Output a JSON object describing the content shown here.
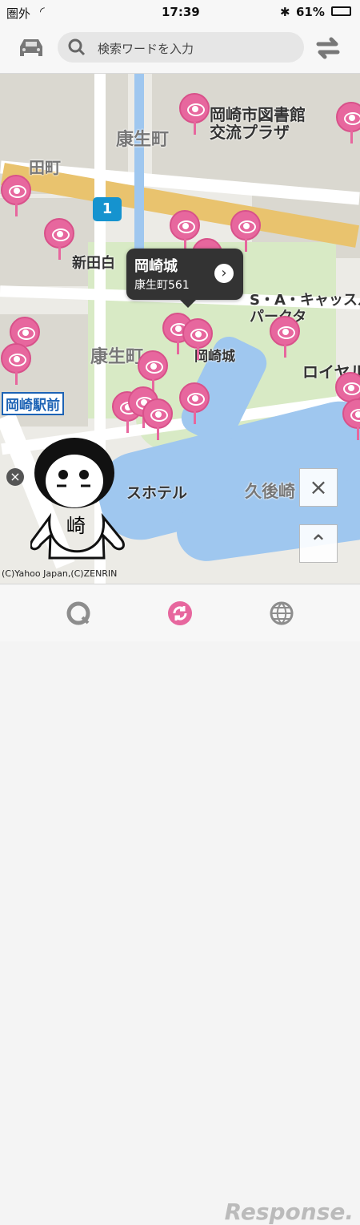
{
  "status": {
    "carrier": "圏外",
    "time": "17:39",
    "battery": "61%"
  },
  "search": {
    "placeholder": "検索ワードを入力"
  },
  "map": {
    "labels": {
      "library": "岡崎市図書館\n交流プラザ",
      "koseicho_top": "康生町",
      "tamachi": "田町",
      "shinden": "新田白",
      "castle": "岡崎城",
      "koseicho_mid": "康生町",
      "sa_castle": "S・A・キャッスル\nパークタ",
      "royal": "ロイヤル",
      "station": "岡崎駅前",
      "hotel": "スホテル",
      "kugo": "久後崎",
      "route": "1"
    },
    "callout": {
      "title": "岡崎城",
      "address": "康生町561"
    },
    "copyright": "(C)Yahoo Japan,(C)ZENRIN",
    "mascot_text": "崎"
  },
  "nav": {
    "icons": [
      "car-icon",
      "refresh-icon",
      "search-icon",
      "sync-icon",
      "globe-icon"
    ]
  },
  "colors": {
    "accent": "#e7679e",
    "map_water": "#9fc7ef",
    "map_park": "#d8eac5"
  },
  "watermark": "Response."
}
